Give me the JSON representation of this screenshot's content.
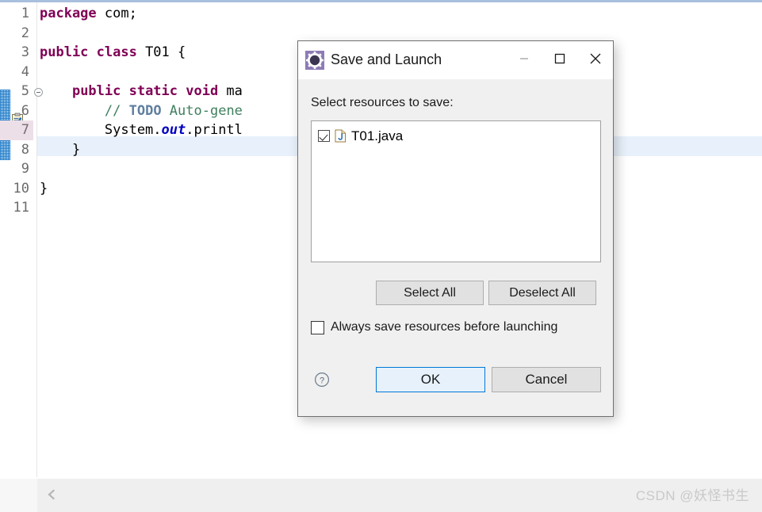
{
  "editor": {
    "line_numbers": [
      "1",
      "2",
      "3",
      "4",
      "5",
      "6",
      "7",
      "8",
      "9",
      "10",
      "11"
    ],
    "current_line": "7",
    "fold_line": "5",
    "todo_marker_line": "6",
    "code_lines": [
      {
        "indent": 0,
        "tokens": [
          {
            "t": "package ",
            "c": "kw"
          },
          {
            "t": "com;",
            "c": "pln"
          }
        ]
      },
      {
        "indent": 0,
        "tokens": []
      },
      {
        "indent": 0,
        "tokens": [
          {
            "t": "public class ",
            "c": "kw"
          },
          {
            "t": "T01 {",
            "c": "pln"
          }
        ]
      },
      {
        "indent": 0,
        "tokens": []
      },
      {
        "indent": 0,
        "tokens": [
          {
            "t": "    ",
            "c": "pln"
          },
          {
            "t": "public static void ",
            "c": "kw"
          },
          {
            "t": "ma",
            "c": "pln"
          }
        ]
      },
      {
        "indent": 0,
        "tokens": [
          {
            "t": "        ",
            "c": "pln"
          },
          {
            "t": "// ",
            "c": "cmt"
          },
          {
            "t": "TODO",
            "c": "todo"
          },
          {
            "t": " Auto-gene",
            "c": "cmt"
          }
        ]
      },
      {
        "indent": 0,
        "tokens": [
          {
            "t": "        System.",
            "c": "pln"
          },
          {
            "t": "out",
            "c": "fld"
          },
          {
            "t": ".printl",
            "c": "pln"
          }
        ]
      },
      {
        "indent": 0,
        "tokens": [
          {
            "t": "    }",
            "c": "pln"
          }
        ]
      },
      {
        "indent": 0,
        "tokens": []
      },
      {
        "indent": 0,
        "tokens": [
          {
            "t": "}",
            "c": "pln"
          }
        ]
      },
      {
        "indent": 0,
        "tokens": []
      }
    ],
    "scroll_left_arrow": "scroll-left-icon"
  },
  "watermark": {
    "text": "CSDN @妖怪书生"
  },
  "dialog": {
    "title": "Save and Launch",
    "app_icon": "eclipse-launch-gear-icon",
    "window_controls": {
      "minimize": "minimize-icon",
      "maximize": "maximize-icon",
      "close": "close-icon"
    },
    "prompt": "Select resources to save:",
    "resources": [
      {
        "label": "T01.java",
        "checked": true,
        "icon": "java-file-icon"
      }
    ],
    "select_all_label": "Select All",
    "deselect_all_label": "Deselect All",
    "always_save": {
      "label": "Always save resources before launching",
      "checked": false
    },
    "help_icon": "help-question-icon",
    "ok_label": "OK",
    "cancel_label": "Cancel"
  },
  "colors": {
    "accent_blue": "#0078d7",
    "keyword_purple": "#7f0055",
    "comment_green": "#3f7f5f",
    "field_blue": "#0000c0",
    "current_line": "#e8f0fb",
    "dialog_bg": "#f0f0f0"
  }
}
